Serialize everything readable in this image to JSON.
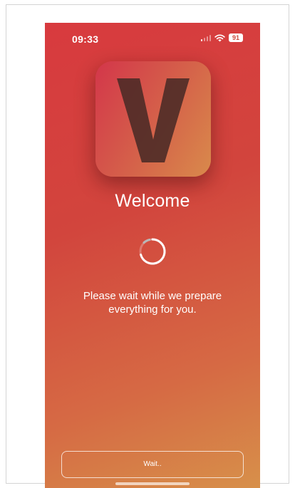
{
  "status_bar": {
    "time": "09:33",
    "battery": "91",
    "icons": [
      "signal-icon",
      "wifi-icon",
      "battery-icon"
    ]
  },
  "logo": {
    "letter": "V",
    "icon": "app-logo-icon"
  },
  "title": "Welcome",
  "spinner": {
    "icon": "loading-spinner-icon"
  },
  "message": {
    "line1": "Please wait while we prepare",
    "line2": "everything for you."
  },
  "button": {
    "label": "Wait.."
  },
  "colors": {
    "gradient_start": "#d83a3e",
    "gradient_end": "#d7904a",
    "text": "#ffffff"
  }
}
